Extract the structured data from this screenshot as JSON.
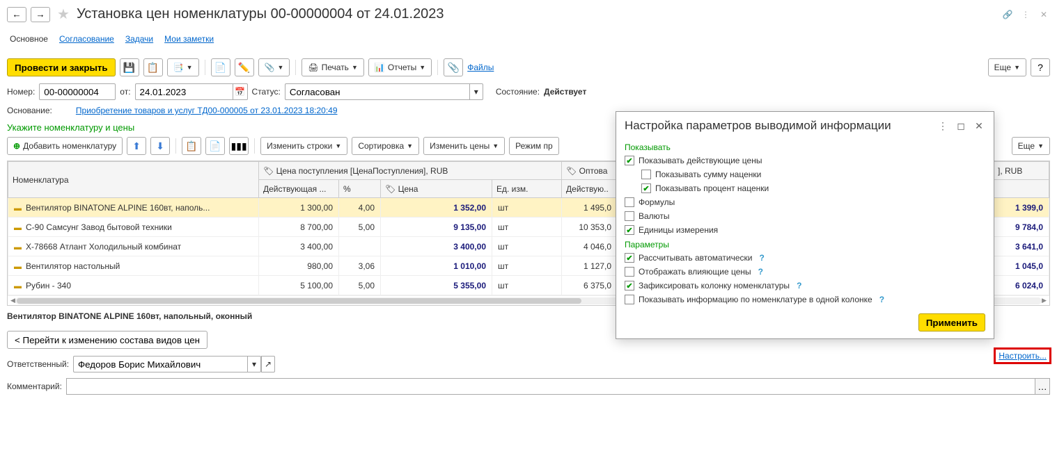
{
  "header": {
    "title": "Установка цен номенклатуры 00-00000004 от 24.01.2023"
  },
  "tabs": {
    "main": "Основное",
    "approval": "Согласование",
    "tasks": "Задачи",
    "notes": "Мои заметки"
  },
  "toolbar": {
    "submit": "Провести и закрыть",
    "print": "Печать",
    "reports": "Отчеты",
    "files": "Файлы",
    "more": "Еще",
    "help": "?"
  },
  "fields": {
    "number_label": "Номер:",
    "number": "00-00000004",
    "from_label": "от:",
    "date": "24.01.2023",
    "status_label": "Статус:",
    "status": "Согласован",
    "state_label": "Состояние:",
    "state": "Действует",
    "basis_label": "Основание:",
    "basis_link": "Приобретение товаров и услуг ТД00-000005 от 23.01.2023 18:20:49"
  },
  "section": {
    "title": "Укажите номенклатуру и цены",
    "add": "Добавить номенклатуру",
    "change_rows": "Изменить строки",
    "sort": "Сортировка",
    "change_prices": "Изменить цены",
    "mode": "Режим пр",
    "more": "Еще"
  },
  "table": {
    "col_item": "Номенклатура",
    "col_arrival": "Цена поступления [ЦенаПоступления], RUB",
    "col_wholesale": "Оптова",
    "col_rub": "], RUB",
    "col_current": "Действующая ...",
    "col_pct": "%",
    "col_price": "Цена",
    "col_unit": "Ед. изм.",
    "col_current2": "Действую..",
    "rows": [
      {
        "name": "Вентилятор BINATONE ALPINE 160вт, наполь...",
        "cur": "1 300,00",
        "pct": "4,00",
        "price": "1 352,00",
        "unit": "шт",
        "cur2": "1 495,0",
        "right": "1 399,0"
      },
      {
        "name": "C-90 Самсунг Завод бытовой техники",
        "cur": "8 700,00",
        "pct": "5,00",
        "price": "9 135,00",
        "unit": "шт",
        "cur2": "10 353,0",
        "right": "9 784,0"
      },
      {
        "name": "X-78668 Атлант Холодильный комбинат",
        "cur": "3 400,00",
        "pct": "",
        "price": "3 400,00",
        "unit": "шт",
        "cur2": "4 046,0",
        "right": "3 641,0"
      },
      {
        "name": "Вентилятор настольный",
        "cur": "980,00",
        "pct": "3,06",
        "price": "1 010,00",
        "unit": "шт",
        "cur2": "1 127,0",
        "right": "1 045,0"
      },
      {
        "name": "Рубин - 340",
        "cur": "5 100,00",
        "pct": "5,00",
        "price": "5 355,00",
        "unit": "шт",
        "cur2": "6 375,0",
        "right": "6 024,0"
      }
    ]
  },
  "footer": {
    "selected": "Вентилятор BINATONE ALPINE 160вт, напольный, оконный",
    "change_types": "< Перейти к изменению состава видов цен",
    "configure": "Настроить...",
    "resp_label": "Ответственный:",
    "resp": "Федоров Борис Михайлович",
    "comment_label": "Комментарий:"
  },
  "popover": {
    "title": "Настройка параметров выводимой информации",
    "sec_show": "Показывать",
    "show_current": "Показывать действующие цены",
    "show_markup_sum": "Показывать сумму наценки",
    "show_markup_pct": "Показывать процент наценки",
    "formulas": "Формулы",
    "currencies": "Валюты",
    "units": "Единицы измерения",
    "sec_params": "Параметры",
    "auto_calc": "Рассчитывать автоматически",
    "show_affecting": "Отображать влияющие цены",
    "fix_column": "Зафиксировать колонку номенклатуры",
    "show_info_one": "Показывать информацию по номенклатуре в одной колонке",
    "apply": "Применить"
  }
}
